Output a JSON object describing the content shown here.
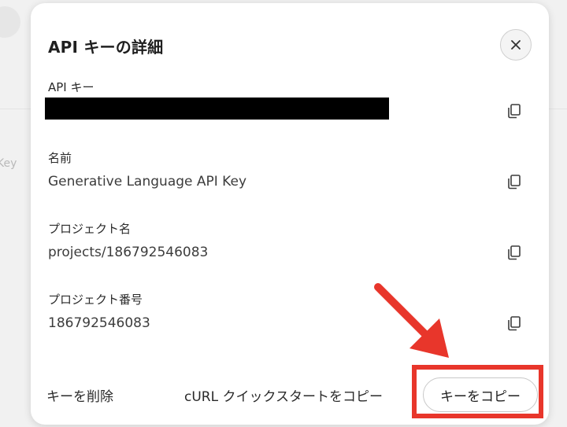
{
  "dialog": {
    "title": "API キーの詳細",
    "close_icon": "close-icon",
    "fields": [
      {
        "label": "API キー",
        "value": "",
        "redacted": true
      },
      {
        "label": "名前",
        "value": "Generative Language API Key"
      },
      {
        "label": "プロジェクト名",
        "value": "projects/186792546083"
      },
      {
        "label": "プロジェクト番号",
        "value": "186792546083"
      }
    ],
    "copy_icon": "copy-icon"
  },
  "footer": {
    "delete_label": "キーを削除",
    "curl_label": "cURL クイックスタートをコピー",
    "copy_key_label": "キーをコピー"
  },
  "background": {
    "partial_text": "Key"
  },
  "annotation": {
    "color": "#e8362b"
  }
}
